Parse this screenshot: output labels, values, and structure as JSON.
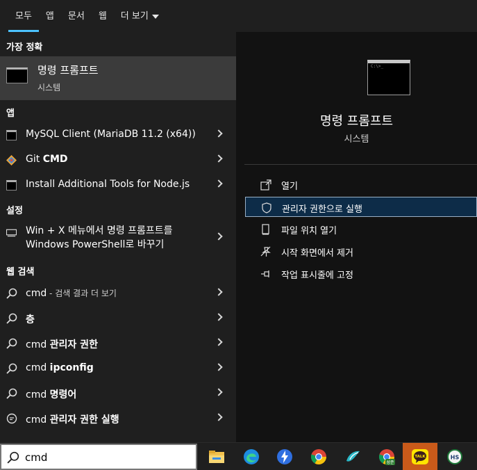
{
  "tabs": [
    {
      "label": "모두",
      "active": true
    },
    {
      "label": "앱"
    },
    {
      "label": "문서"
    },
    {
      "label": "웹"
    },
    {
      "label": "더 보기"
    }
  ],
  "sections": {
    "best_match": "가장 정확",
    "apps": "앱",
    "settings": "설정",
    "web": "웹 검색"
  },
  "best_match": {
    "title": "명령 프롬프트",
    "subtitle": "시스템"
  },
  "apps": [
    {
      "label": "MySQL Client (MariaDB 11.2 (x64))"
    },
    {
      "label_pre": "Git ",
      "label_bold": "CMD"
    },
    {
      "label": "Install Additional Tools for Node.js"
    }
  ],
  "settings": {
    "line1": "Win + X 메뉴에서 명령 프롬프트를",
    "line2": "Windows PowerShell로 바꾸기"
  },
  "web": [
    {
      "pre": "cmd",
      "bold": "",
      "suffix": " - 검색 결과 더 보기"
    },
    {
      "pre": "",
      "bold": "층",
      "suffix": ""
    },
    {
      "pre": "cmd ",
      "bold": "관리자 권한",
      "suffix": ""
    },
    {
      "pre": "cmd ",
      "bold": "ipconfig",
      "suffix": ""
    },
    {
      "pre": "cmd ",
      "bold": "명령어",
      "suffix": ""
    },
    {
      "pre": "cmd ",
      "bold": "관리자 권한 실행",
      "suffix": ""
    }
  ],
  "detail": {
    "title": "명령 프롬프트",
    "kind": "시스템",
    "actions": [
      {
        "label": "열기",
        "icon": "open-icon"
      },
      {
        "label": "관리자 권한으로 실행",
        "icon": "shield-icon",
        "selected": true
      },
      {
        "label": "파일 위치 열기",
        "icon": "file-location-icon"
      },
      {
        "label": "시작 화면에서 제거",
        "icon": "unpin-icon"
      },
      {
        "label": "작업 표시줄에 고정",
        "icon": "pin-icon"
      }
    ]
  },
  "search": {
    "value": "cmd"
  },
  "taskbar": {
    "apps": [
      "file-explorer-icon",
      "edge-icon",
      "app-blue-icon",
      "chrome-icon",
      "app-bird-icon",
      "chrome-profile-icon",
      "kakaotalk-icon",
      "hs-app-icon"
    ],
    "kakao_text": "TALK",
    "hs_text": "HS",
    "chrome_badge": "성준",
    "highlight_color": "#c95a1a"
  }
}
